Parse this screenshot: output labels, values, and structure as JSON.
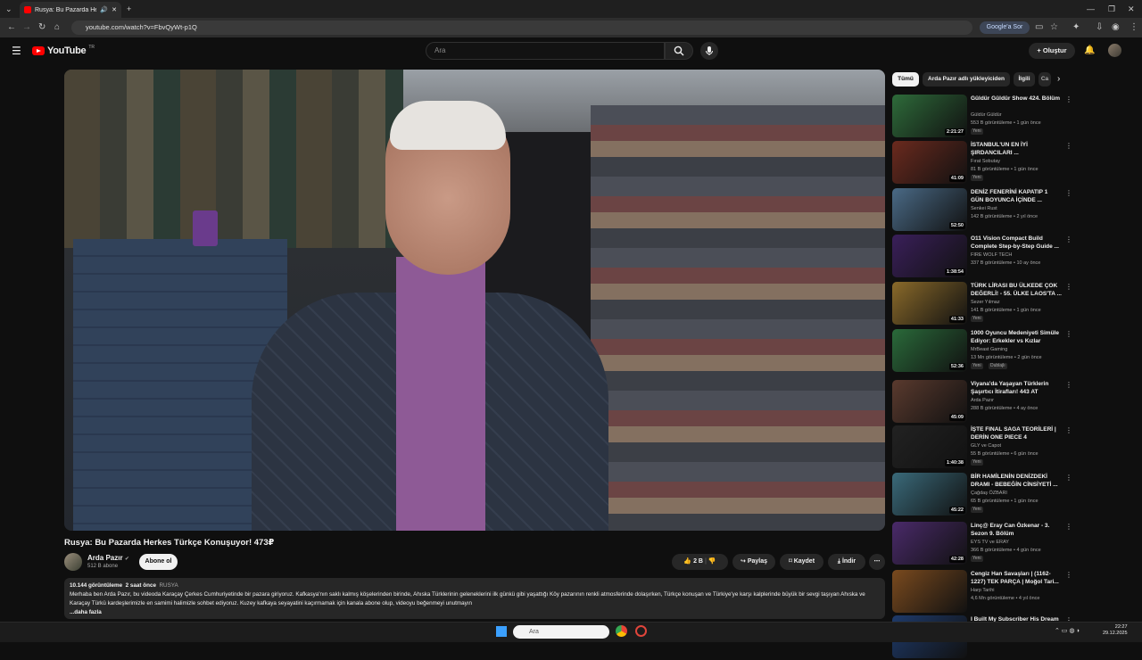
{
  "browser": {
    "tab_title": "Rusya: Bu Pazarda Herkes T",
    "url": "youtube.com/watch?v=FbvQyWt-p1Q",
    "google_ask": "Google'a Sor"
  },
  "yt": {
    "logo_text": "YouTube",
    "logo_region": "TR",
    "search_placeholder": "Ara",
    "create_label": "Oluştur"
  },
  "video": {
    "title": "Rusya: Bu Pazarda Herkes Türkçe Konuşuyor! 473₽",
    "channel": "Arda Pazır",
    "subscribers": "512 B abone",
    "subscribe_label": "Abone ol",
    "likes": "2 B",
    "share_label": "Paylaş",
    "save_label": "Kaydet",
    "download_label": "İndir",
    "views": "10.144 görüntüleme",
    "age": "2 saat önce",
    "tag": "RUSYA",
    "description": "Merhaba ben Arda Pazır, bu videoda Karaçay Çerkes Cumhuriyetinde bir pazara giriyoruz. Kafkasya'nın saklı kalmış köşelerinden birinde, Ahıska Türklerinin geleneklerini ilk günkü gibi yaşattığı Köy pazarının renkli atmosferinde dolaşırken, Türkçe konuşan ve Türkiye'ye karşı kalplerinde büyük bir sevgi taşıyan Ahıska ve Karaçay Türkü kardeşlerimizle en samimi halimizle sohbet ediyoruz. Kuzey kafkaya seyayatini kaçırmamak için kanala abone olup, videoyu beğenmeyi unutmayın",
    "more_label": "...daha fazla"
  },
  "chips": [
    "Tümü",
    "Arda Pazır adlı yükleyiciden",
    "İlgili",
    "Ca"
  ],
  "sidebar": [
    {
      "title": "Güldür Güldür Show 424. Bölüm",
      "channel": "Güldür Güldür",
      "meta": "553 B görüntüleme • 1 gün önce",
      "badge": "Yeni",
      "duration": "2:21:27",
      "color": "#2e6b3a"
    },
    {
      "title": "İSTANBUL'UN EN İYİ ŞIRDANCILARI ...",
      "channel": "Fırat Sobutay",
      "meta": "81 B görüntüleme • 1 gün önce",
      "badge": "Yeni",
      "duration": "41:09",
      "color": "#6b2a1e"
    },
    {
      "title": "DENİZ FENERİNİ KAPATIP 1 GÜN BOYUNCA İÇİNDE ...",
      "channel": "Senkei Rust",
      "meta": "142 B görüntüleme • 2 yıl önce",
      "badge": "",
      "duration": "52:50",
      "color": "#4a6a86"
    },
    {
      "title": "O11 Vision Compact Build Complete Step-by-Step Guide ...",
      "channel": "FIRE WOLF TECH",
      "meta": "337 B görüntüleme • 10 ay önce",
      "badge": "",
      "duration": "1:38:54",
      "color": "#3a1f5a"
    },
    {
      "title": "TÜRK LİRASI BU ÜLKEDE ÇOK DEĞERLİ! - 55. ÜLKE LAOS'TA ...",
      "channel": "Sezer Yılmaz",
      "meta": "141 B görüntüleme • 1 gün önce",
      "badge": "Yeni",
      "duration": "41:33",
      "color": "#8a6a2a"
    },
    {
      "title": "1000 Oyuncu Medeniyeti Simüle Ediyor: Erkekler vs Kızlar",
      "channel": "MrBeast Gaming",
      "meta": "13 Mn görüntüleme • 2 gün önce",
      "badge": "Yeni",
      "badge2": "Dublajlı",
      "duration": "52:36",
      "color": "#2a6a3a"
    },
    {
      "title": "Viyana'da Yaşayan Türklerin Şaşırtıcı İtirafları! 443 AT",
      "channel": "Arda Pazır",
      "meta": "288 B görüntüleme • 4 ay önce",
      "badge": "",
      "duration": "45:09",
      "color": "#5a3a2e"
    },
    {
      "title": "İŞTE FINAL SAGA TEORİLERİ | DERİN ONE PIECE 4",
      "channel": "GLY ve Capot",
      "meta": "55 B görüntüleme • 6 gün önce",
      "badge": "Yeni",
      "duration": "1:40:38",
      "color": "#222"
    },
    {
      "title": "BİR HAMİLENİN DENİZDEKİ DRAMI - BEBEĞİN CİNSİYETİ ...",
      "channel": "Çağdaş ÖZBARI",
      "meta": "65 B görüntüleme • 1 gün önce",
      "badge": "Yeni",
      "duration": "45:22",
      "color": "#3a6a7a"
    },
    {
      "title": "Linç@ Eray Can Özkenar - 3. Sezon 9. Bölüm",
      "channel": "EYS TV ve ERAY",
      "meta": "366 B görüntüleme • 4 gün önce",
      "badge": "Yeni",
      "duration": "42:28",
      "color": "#4a2a6a"
    },
    {
      "title": "Cengiz Han Savaşları | (1162-1227) TEK PARÇA | Moğol Tari...",
      "channel": "Harp Tarihi",
      "meta": "4,6 Mn görüntüleme • 4 yıl önce",
      "badge": "",
      "duration": "",
      "color": "#7a4a1e"
    },
    {
      "title": "I Built My Subscriber His Dream ...",
      "channel": "",
      "meta": "",
      "badge": "",
      "duration": "",
      "color": "#1e3a6a"
    }
  ],
  "taskbar": {
    "search_placeholder": "Ara",
    "time": "22:27",
    "date": "29.12.2025"
  }
}
